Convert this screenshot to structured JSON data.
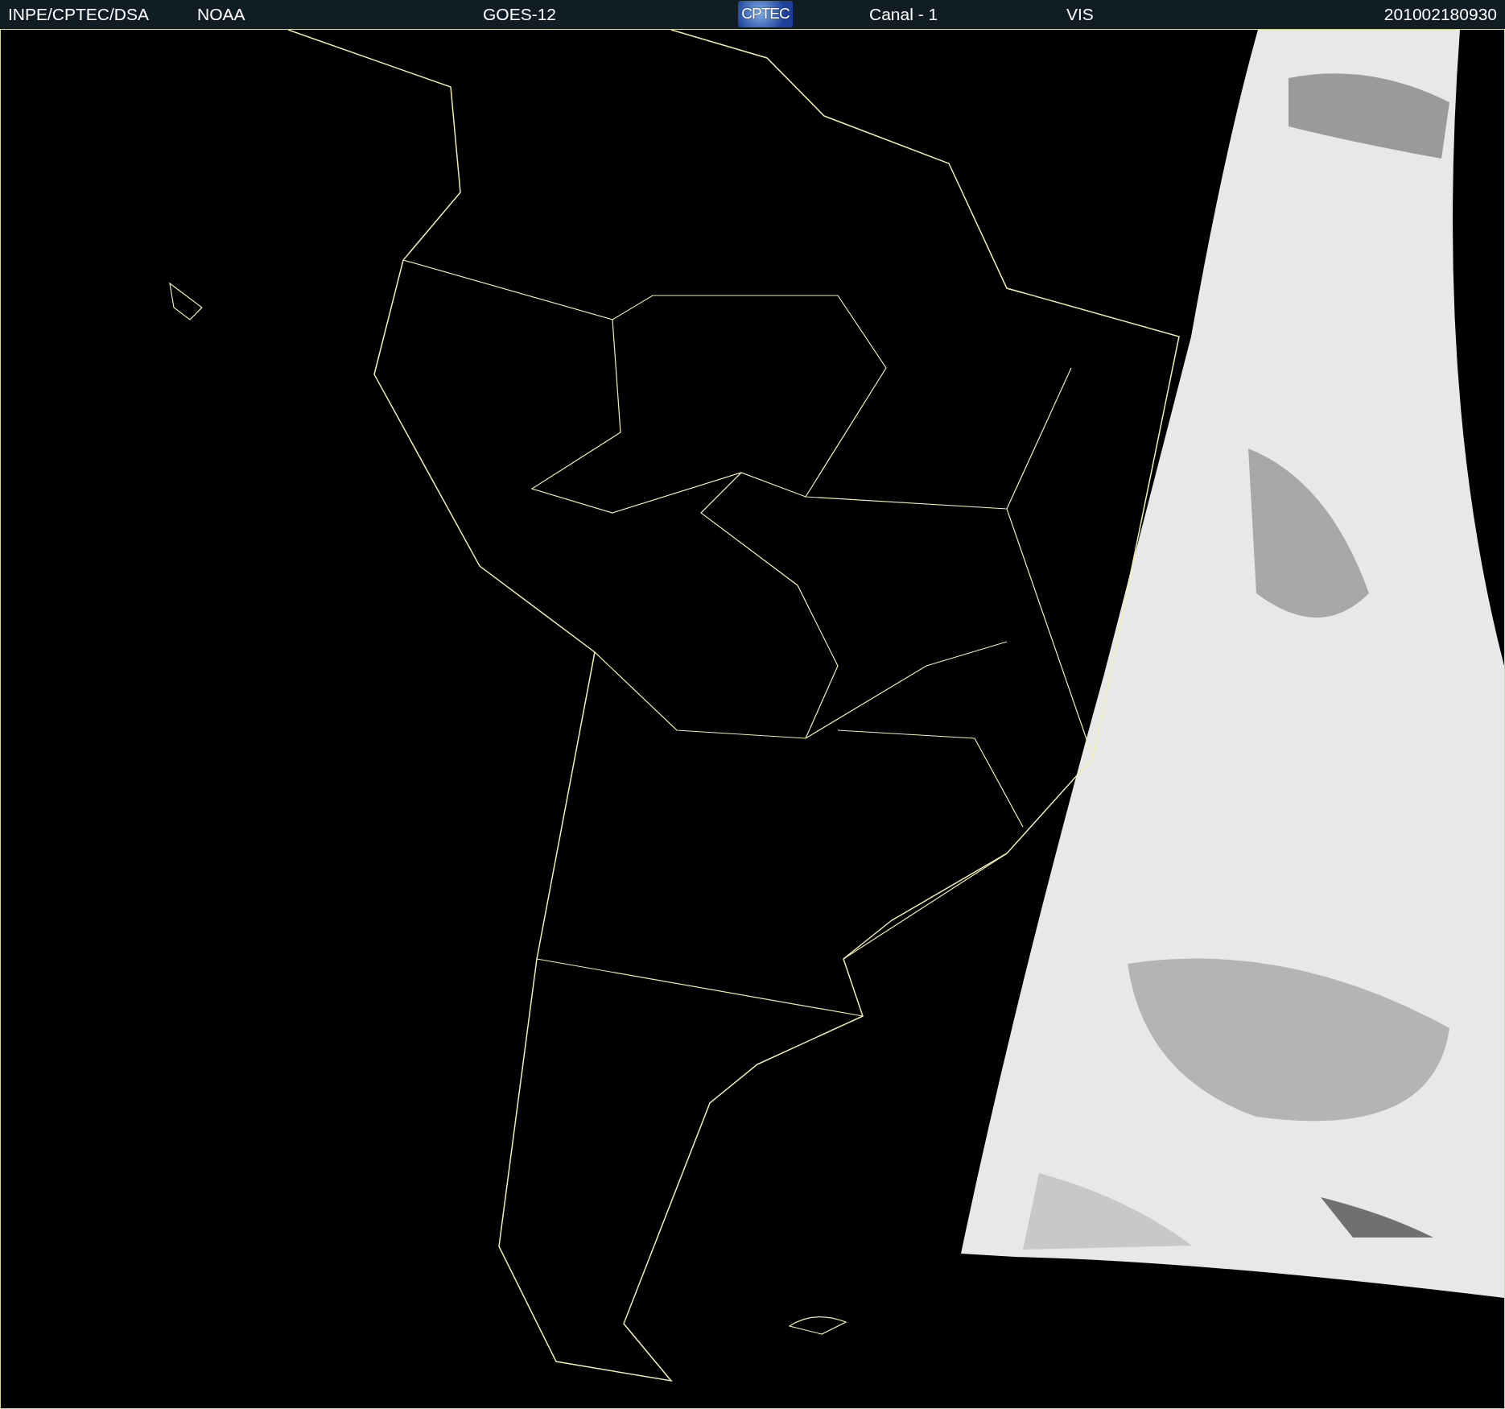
{
  "header": {
    "items": [
      {
        "kind": "text",
        "label": "INPE/CPTEC/DSA"
      },
      {
        "kind": "text",
        "label": "NOAA"
      },
      {
        "kind": "text",
        "label": "GOES-12"
      },
      {
        "kind": "logo",
        "label": "CPTEC"
      },
      {
        "kind": "text",
        "label": "Canal - 1"
      },
      {
        "kind": "text",
        "label": "VIS"
      },
      {
        "kind": "text",
        "label": "201002180930"
      }
    ]
  }
}
